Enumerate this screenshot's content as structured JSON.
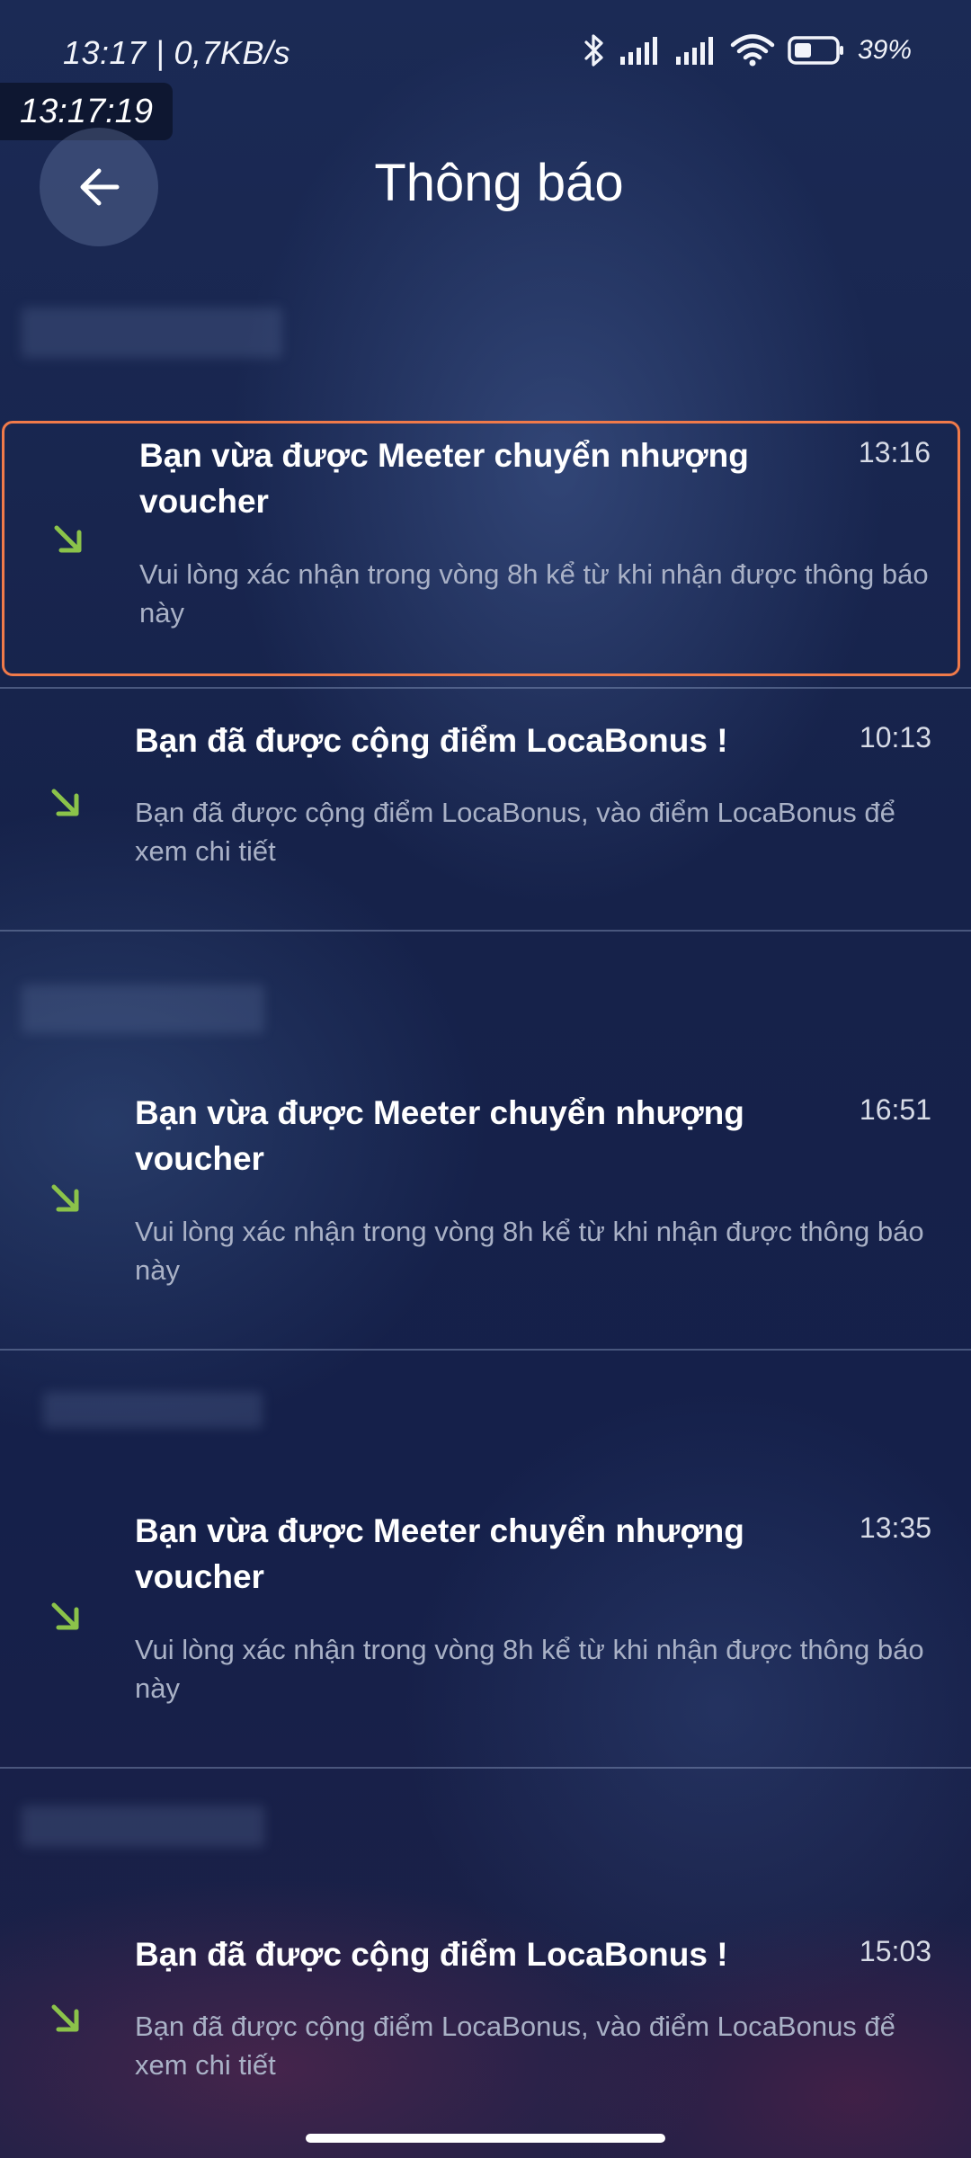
{
  "status_bar": {
    "time_and_speed": "13:17 | 0,7KB/s",
    "battery_percent": "39%",
    "icons": [
      "bluetooth-icon",
      "signal-icon",
      "signal-icon",
      "wifi-icon",
      "battery-icon"
    ]
  },
  "clock_overlay": "13:17:19",
  "header": {
    "title": "Thông báo",
    "back_icon": "arrow-left-icon"
  },
  "colors": {
    "accent_arrow": "#8bc34a",
    "highlight_border": "#f07a4a"
  },
  "notifications": [
    {
      "title": "Bạn vừa được Meeter chuyển nhượng voucher",
      "time": "13:16",
      "body": "Vui lòng xác nhận trong vòng 8h kể từ khi nhận được thông báo này",
      "icon": "arrow-down-right-icon",
      "highlighted": true
    },
    {
      "title": "Bạn đã được cộng điểm LocaBonus !",
      "time": "10:13",
      "body": "Bạn đã được cộng điểm LocaBonus, vào điểm LocaBonus để xem chi tiết",
      "icon": "arrow-down-right-icon",
      "highlighted": false
    },
    {
      "title": "Bạn vừa được Meeter chuyển nhượng voucher",
      "time": "16:51",
      "body": "Vui lòng xác nhận trong vòng 8h kể từ khi nhận được thông báo này",
      "icon": "arrow-down-right-icon",
      "highlighted": false
    },
    {
      "title": "Bạn vừa được Meeter chuyển nhượng voucher",
      "time": "13:35",
      "body": "Vui lòng xác nhận trong vòng 8h kể từ khi nhận được thông báo này",
      "icon": "arrow-down-right-icon",
      "highlighted": false
    },
    {
      "title": "Bạn đã được cộng điểm LocaBonus !",
      "time": "15:03",
      "body": "Bạn đã được cộng điểm LocaBonus, vào điểm LocaBonus để xem chi tiết",
      "icon": "arrow-down-right-icon",
      "highlighted": false
    }
  ]
}
